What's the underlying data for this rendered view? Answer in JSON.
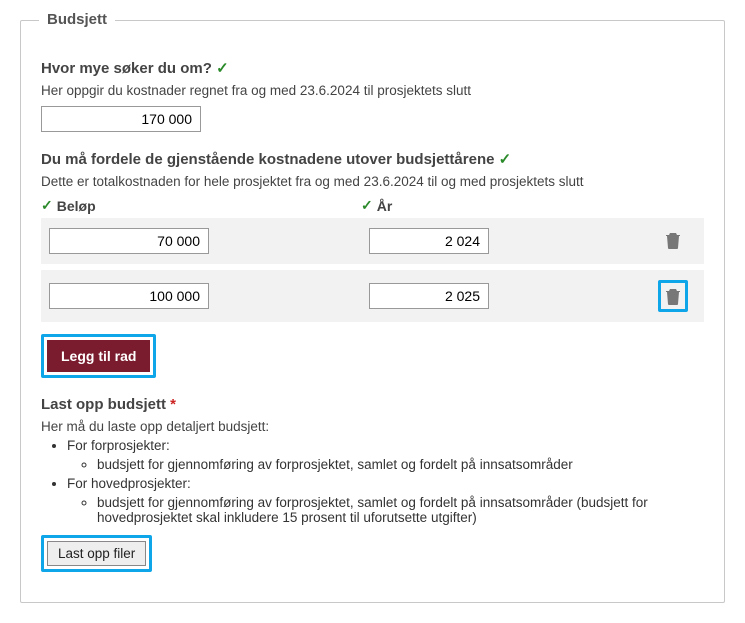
{
  "legend": "Budsjett",
  "s1": {
    "title": "Hvor mye søker du om?",
    "desc": "Her oppgir du kostnader regnet fra og med 23.6.2024 til prosjektets slutt",
    "value": "170 000"
  },
  "s2": {
    "title": "Du må fordele de gjenstående kostnadene utover budsjettårene",
    "desc": "Dette er totalkostnaden for hele prosjektet fra og med 23.6.2024 til og med prosjektets slutt",
    "col_amount": "Beløp",
    "col_year": "År",
    "rows": [
      {
        "amount": "70 000",
        "year": "2 024"
      },
      {
        "amount": "100 000",
        "year": "2 025"
      }
    ],
    "add_row": "Legg til rad"
  },
  "s3": {
    "title": "Last opp budsjett",
    "desc": "Her må du laste opp detaljert budsjett:",
    "b1": "For forprosjekter:",
    "b1a": "budsjett for gjennomføring av forprosjektet, samlet og fordelt på innsatsområder",
    "b2": "For hovedprosjekter:",
    "b2a": "budsjett for gjennomføring av forprosjektet, samlet og fordelt på innsatsområder (budsjett for hovedprosjektet skal inkludere 15 prosent til uforutsette utgifter)",
    "upload": "Last opp filer"
  }
}
